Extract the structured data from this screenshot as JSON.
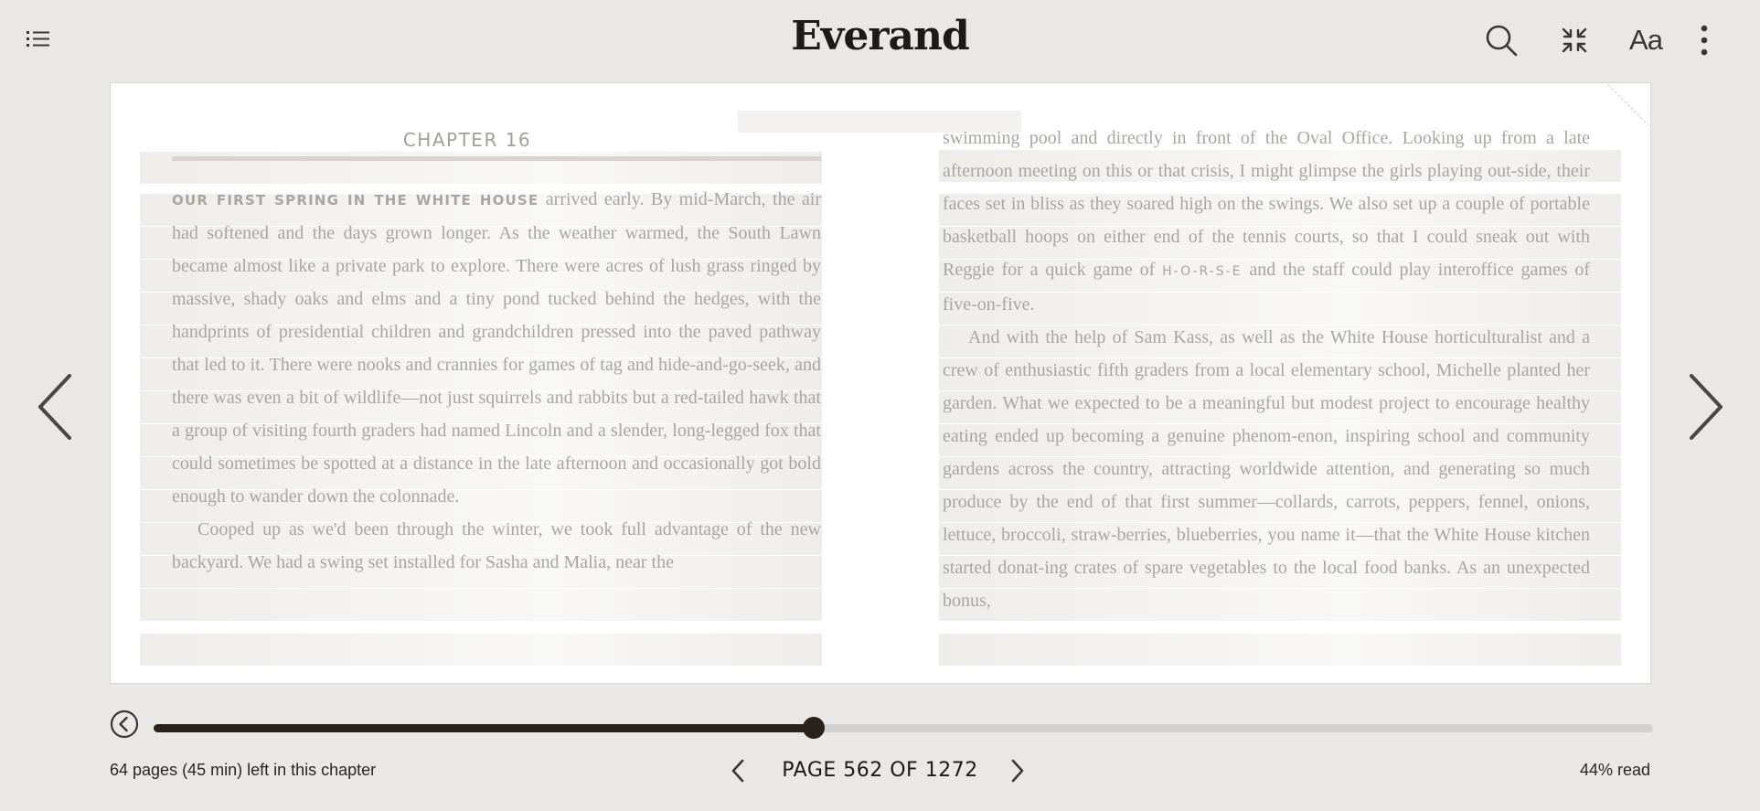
{
  "app": {
    "brand": "Everand",
    "toc_icon": "list-icon",
    "search_icon": "search-icon",
    "fullscreen_icon": "fullscreen-icon",
    "font_settings_label": "Aa",
    "more_icon": "more-vertical-icon"
  },
  "book": {
    "chapter_heading": "CHAPTER 16",
    "left_lead_smallcaps": "OUR FIRST SPRING IN THE WHITE HOUSE",
    "left_para1_rest": " arrived early. By mid-March, the air had softened and the days grown longer. As the weather warmed, the South Lawn became almost like a private park to explore. There were acres of lush grass ringed by massive, shady oaks and elms and a tiny pond tucked behind the hedges, with the handprints of presidential children and grandchildren pressed into the paved pathway that led to it. There were nooks and crannies for games of tag and hide-and-go-seek, and there was even a bit of wildlife—not just squirrels and rabbits but a red-tailed hawk that a group of visiting fourth graders had named Lincoln and a slender, long-legged fox that could sometimes be spotted at a distance in the late afternoon and occasionally got bold enough to wander down the colonnade.",
    "left_para2": "Cooped up as we'd been through the winter, we took full advantage of the new backyard. We had a swing set installed for Sasha and Malia, near the",
    "right_para1_before": "swimming pool and directly in front of the Oval Office. Looking up from a late afternoon meeting on this or that crisis, I might glimpse the girls playing out-side, their faces set in bliss as they soared high on the swings. We also set up a couple of portable basketball hoops on either end of the tennis courts, so that I could sneak out with Reggie for a quick game of ",
    "right_para1_horse": "H-O-R-S-E",
    "right_para1_after": " and the staff could play interoffice games of five-on-five.",
    "right_para2": "And with the help of Sam Kass, as well as the White House horticulturalist and a crew of enthusiastic fifth graders from a local elementary school, Michelle planted her garden. What we expected to be a meaningful but modest project to encourage healthy eating ended up becoming a genuine phenom-enon, inspiring school and community gardens across the country, attracting worldwide attention, and generating so much produce by the end of that first summer—collards, carrots, peppers, fennel, onions, lettuce, broccoli, straw-berries, blueberries, you name it—that the White House kitchen started donat-ing crates of spare vegetables to the local food banks. As an unexpected bonus,"
  },
  "navigation": {
    "prev_page_icon": "chevron-left-icon",
    "next_page_icon": "chevron-right-icon",
    "back_icon": "circle-back-icon"
  },
  "progress": {
    "fraction": 0.44
  },
  "footer": {
    "remaining": "64 pages (45 min) left in this chapter",
    "page_label": "PAGE 562 OF 1272",
    "percent_read": "44% read"
  }
}
